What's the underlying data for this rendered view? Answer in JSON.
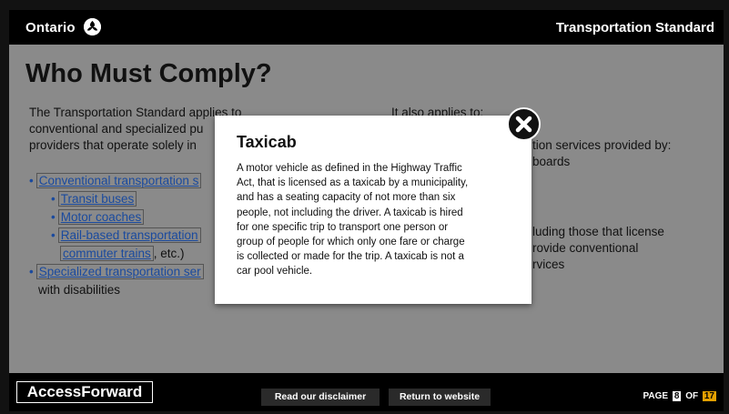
{
  "header": {
    "brand": "Ontario",
    "course_title": "Transportation Standard"
  },
  "main": {
    "title": "Who Must Comply?",
    "intro_lines": [
      "The Transportation Standard applies to",
      "conventional and specialized pu",
      "providers that operate solely in"
    ],
    "applies_lines": [
      "It also applies to:",
      "tion services provided by:",
      "boards",
      "luding those that license",
      "rovide conventional",
      "rvices"
    ],
    "list": {
      "conventional": "Conventional transportation s",
      "transit_buses": "Transit buses",
      "motor_coaches": "Motor coaches",
      "rail": "Rail-based transportation",
      "commuter": "commuter trains",
      "commuter_suffix": ", etc.)",
      "specialized": "Specialized transportation ser",
      "disabilities": "with disabilities"
    }
  },
  "modal": {
    "title": "Taxicab",
    "lines": [
      "A motor vehicle as defined in the Highway Traffic",
      "Act, that is licensed as a taxicab by a municipality,",
      "and has a seating capacity of not more than six",
      "people, not including the driver. A taxicab is hired",
      "for one specific trip to transport one person or",
      "group of people for which only one fare or charge",
      "is collected or made for the trip. A taxicab is not a",
      "car pool vehicle."
    ],
    "close_icon": "close-icon"
  },
  "footer": {
    "logo": "AccessForward",
    "disclaimer_label": "Read our disclaimer",
    "return_label": "Return to website",
    "page_label": "PAGE",
    "page_number": "8",
    "of_label": "OF",
    "page_total": "17"
  },
  "colors": {
    "overlay": "#8a8a8a",
    "bar": "#000000",
    "link": "#1a4a9e",
    "page_total_accent": "#e4a000"
  }
}
